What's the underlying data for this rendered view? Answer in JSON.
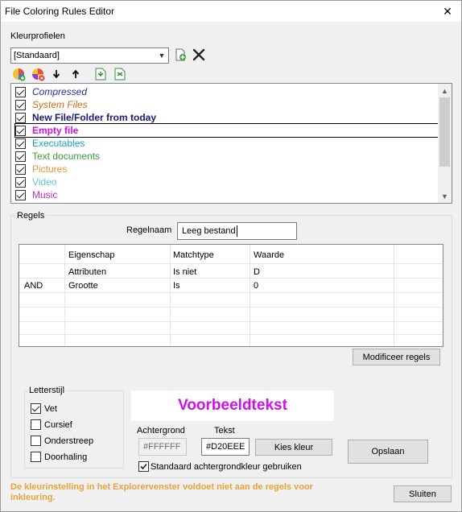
{
  "window": {
    "title": "File Coloring Rules Editor",
    "close_glyph": "✕"
  },
  "profiles": {
    "label": "Kleurprofielen",
    "selected": "[Standaard]",
    "new_icon": "new-profile-icon",
    "delete_icon": "delete-profile-icon"
  },
  "toolbar": {
    "icons": [
      "add-rule-icon",
      "edit-rule-icon",
      "move-down-icon",
      "move-up-icon",
      "import-icon",
      "export-icon"
    ]
  },
  "rule_list": {
    "items": [
      {
        "label": "Compressed",
        "color": "#2a2aa0",
        "italic": true,
        "bold": false,
        "checked": true
      },
      {
        "label": "System Files",
        "color": "#d2691e",
        "italic": true,
        "bold": false,
        "checked": true
      },
      {
        "label": "New File/Folder from today",
        "color": "#1a1a7a",
        "italic": false,
        "bold": true,
        "checked": true
      },
      {
        "label": "Empty file",
        "color": "#d20eee",
        "italic": false,
        "bold": true,
        "checked": true,
        "selected": true
      },
      {
        "label": "Executables",
        "color": "#20a0c8",
        "italic": false,
        "bold": false,
        "checked": true
      },
      {
        "label": "Text documents",
        "color": "#3a9a3a",
        "italic": false,
        "bold": false,
        "checked": true
      },
      {
        "label": "Pictures",
        "color": "#e8913a",
        "italic": false,
        "bold": false,
        "checked": true
      },
      {
        "label": "Video",
        "color": "#5ac8c8",
        "italic": false,
        "bold": false,
        "checked": true
      },
      {
        "label": "Music",
        "color": "#c828c8",
        "italic": false,
        "bold": false,
        "checked": true
      }
    ]
  },
  "rules": {
    "group_label": "Regels",
    "name_label": "Regelnaam",
    "name_value": "Leeg bestand",
    "columns": [
      "",
      "Eigenschap",
      "Matchtype",
      "Waarde"
    ],
    "rows": [
      [
        "",
        "Attributen",
        "Is niet",
        "D"
      ],
      [
        "AND",
        "Grootte",
        "Is",
        "0"
      ]
    ],
    "modify_button": "Modificeer regels"
  },
  "font_style": {
    "group_label": "Letterstijl",
    "options": [
      {
        "label": "Vet",
        "checked": true
      },
      {
        "label": "Cursief",
        "checked": false
      },
      {
        "label": "Onderstreep",
        "checked": false
      },
      {
        "label": "Doorhaling",
        "checked": false
      }
    ]
  },
  "preview": {
    "text": "Voorbeeldtekst",
    "color": "#D20EEE"
  },
  "colors": {
    "background_label": "Achtergrond",
    "background_value": "#FFFFFF",
    "text_label": "Tekst",
    "text_value": "#D20EEE",
    "pick_button": "Kies kleur",
    "default_bg_checkbox": "Standaard achtergrondkleur gebruiken",
    "default_bg_checked": true
  },
  "save_button": "Opslaan",
  "warning": "De kleurinstelling in het Explorervenster voldoet niet aan de regels voor inkleuring.",
  "close_button": "Sluiten",
  "accent": {
    "warning": "#e8a33a",
    "selection_outline": "#000000"
  }
}
